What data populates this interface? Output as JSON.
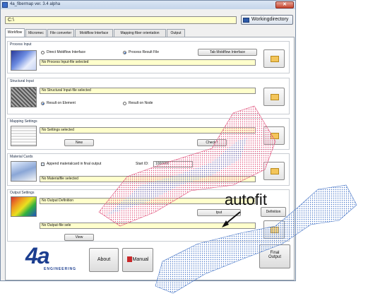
{
  "window": {
    "title": "4a_fibermap ver. 3.4 alpha",
    "path_value": "C:\\",
    "working_directory_button": "Workingdirectory"
  },
  "tabs": [
    {
      "label": "Workflow",
      "active": true
    },
    {
      "label": "Micromec",
      "active": false
    },
    {
      "label": "File converter",
      "active": false
    },
    {
      "label": "Moldflow Interface",
      "active": false
    },
    {
      "label": "Mapping fiber orientation",
      "active": false
    },
    {
      "label": "Output",
      "active": false
    }
  ],
  "process_input": {
    "title": "Process Input",
    "radio_direct": "Direct Moldflow Interface",
    "radio_result": "Process Result File",
    "tab_button": "Tab Moldflow Interface",
    "status": "No Process Input-file selected"
  },
  "structural_input": {
    "title": "Structural Input",
    "status": "No Structural Input-file selected",
    "radio_element": "Result on Element",
    "radio_node": "Result on Node"
  },
  "mapping_settings": {
    "title": "Mapping Settings",
    "status": "No Settings selected",
    "new_button": "New",
    "check_button": "Check r"
  },
  "material_cards": {
    "title": "Material Cards",
    "append_label": "Append materialcard in final output",
    "start_id_label": "Start ID:",
    "start_id_value": "1000000",
    "status": "No Materialfile selected"
  },
  "output_settings": {
    "title": "Output Settings",
    "definition_status": "No Output Definition",
    "output_file_status": "No Output-file sele",
    "output_button": "tput",
    "definition_button": "Definition",
    "view_button": "View"
  },
  "bottom": {
    "about_button": "About",
    "manual_button": "Manual",
    "final_output_line1": "Final",
    "final_output_line2": "Output",
    "logo_text": "4a",
    "logo_sub": "ENGINEERING"
  },
  "annotation": {
    "autofit": "autofit"
  },
  "colors": {
    "field_bg": "#ffffcc",
    "mesh_red": "#e0507a",
    "mesh_blue": "#4a78c8",
    "logo_blue": "#1b3d8f"
  }
}
